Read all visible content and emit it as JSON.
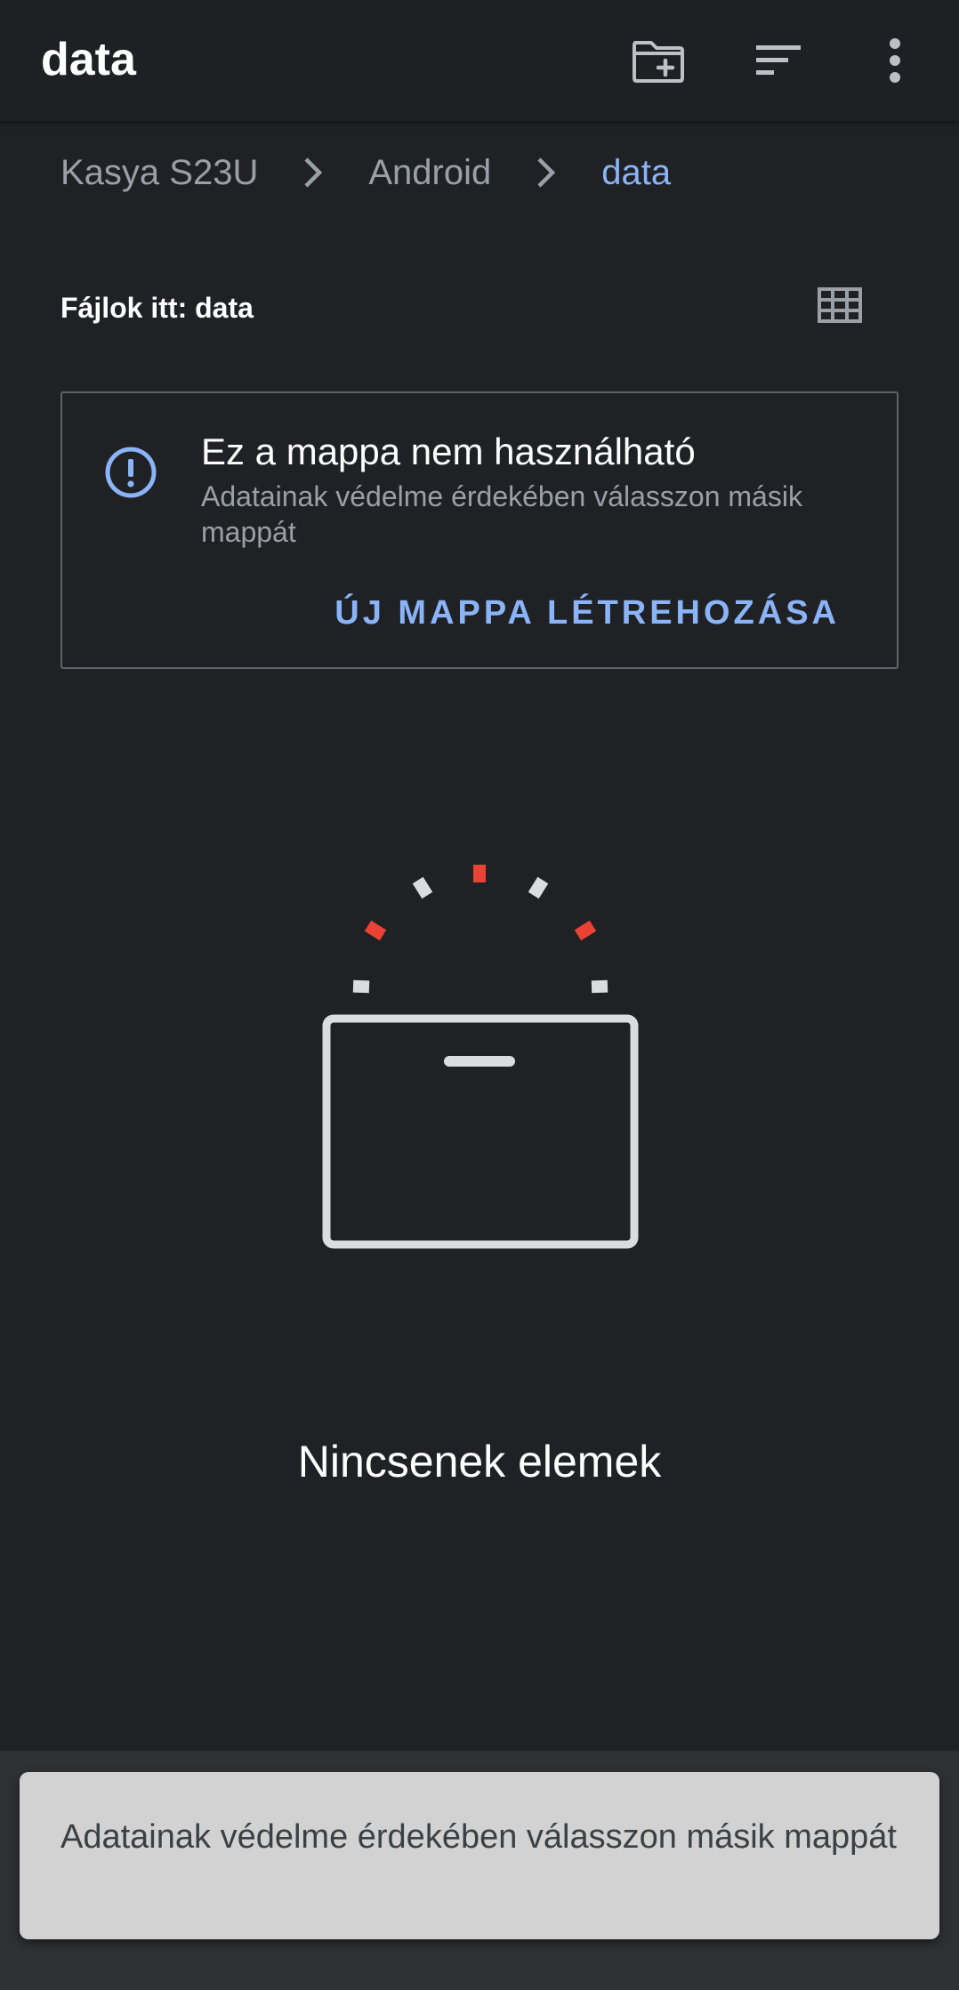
{
  "appbar": {
    "title": "data",
    "icons": [
      "create-new-folder-icon",
      "sort-icon",
      "more-vert-icon"
    ]
  },
  "breadcrumb": {
    "items": [
      {
        "label": "Kasya S23U"
      },
      {
        "label": "Android"
      },
      {
        "label": "data"
      }
    ]
  },
  "section": {
    "title": "Fájlok itt: data",
    "view_toggle_icon": "grid-view-icon"
  },
  "warning_card": {
    "icon": "info-alert-icon",
    "title": "Ez a mappa nem használható",
    "text": "Adatainak védelme érdekében válasszon másik mappát",
    "action_label": "ÚJ MAPPA LÉTREHOZÁSA"
  },
  "empty_state": {
    "text": "Nincsenek elemek"
  },
  "snackbar": {
    "text": "Adatainak védelme érdekében válasszon másik mappát"
  },
  "colors": {
    "background": "#202124",
    "accent": "#8ab4f8",
    "secondary_text": "#9aa0a6",
    "illustration_red": "#ea4335",
    "illustration_light": "#dadce0",
    "snackbar_bg": "#d2d2d2"
  }
}
